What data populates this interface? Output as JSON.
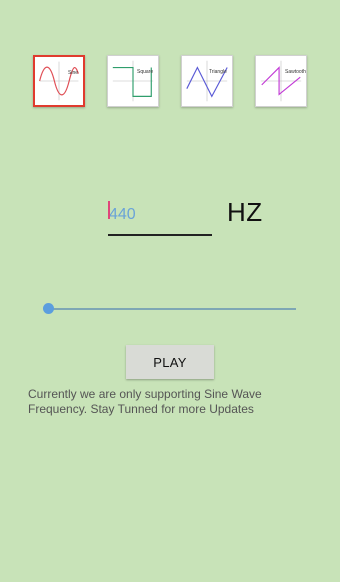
{
  "waveforms": [
    {
      "label": "Sine",
      "selected": true,
      "icon": "sine-wave-icon"
    },
    {
      "label": "Square",
      "selected": false,
      "icon": "square-wave-icon"
    },
    {
      "label": "Triangle",
      "selected": false,
      "icon": "triangle-wave-icon"
    },
    {
      "label": "Sawtooth",
      "selected": false,
      "icon": "sawtooth-wave-icon"
    }
  ],
  "frequency": {
    "value": "",
    "placeholder": "440",
    "unit": "HZ"
  },
  "slider": {
    "value": 0
  },
  "play_label": "PLAY",
  "info_text": "Currently we are only supporting Sine Wave Frequency. Stay Tunned for more Updates",
  "colors": {
    "background": "#c8e3b8",
    "selected_border": "#e03b2e",
    "accent": "#5b9ede"
  }
}
